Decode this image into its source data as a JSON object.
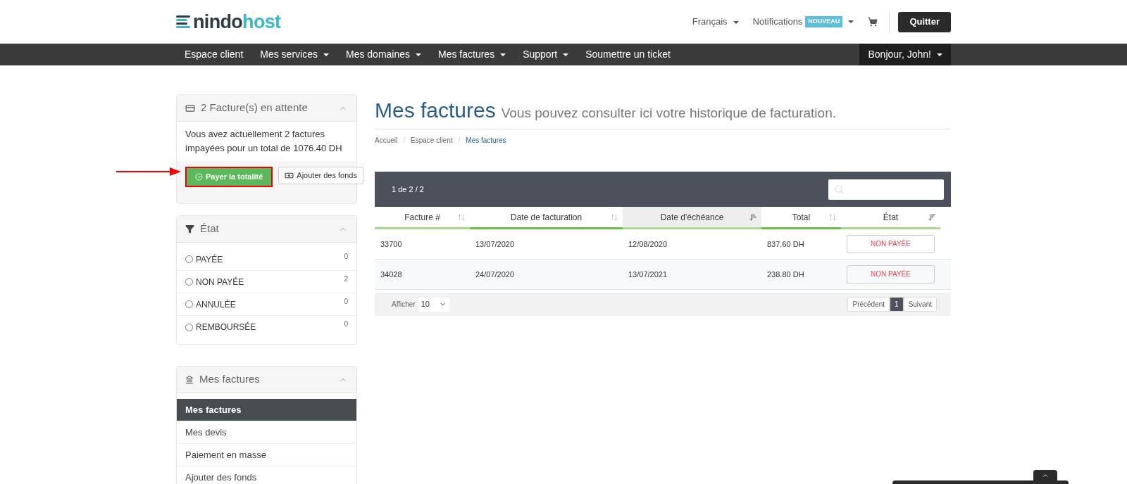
{
  "logo": {
    "dark": "nindo",
    "accent": "host"
  },
  "top_links": {
    "language": "Français",
    "notifications": "Notifications",
    "notifications_badge": "NOUVEAU",
    "logout": "Quitter"
  },
  "nav": {
    "items": [
      {
        "label": "Espace client",
        "dropdown": false
      },
      {
        "label": "Mes services",
        "dropdown": true
      },
      {
        "label": "Mes domaines",
        "dropdown": true
      },
      {
        "label": "Mes factures",
        "dropdown": true
      },
      {
        "label": "Support",
        "dropdown": true
      },
      {
        "label": "Soumettre un ticket",
        "dropdown": false
      }
    ],
    "user": "Bonjour, John!"
  },
  "pending_panel": {
    "title": "2 Facture(s) en attente",
    "message": "Vous avez actuellement 2 factures impayées pour un total de 1076.40 DH",
    "pay_button": "Payer la totalité",
    "pay_highlighted": true,
    "funds_button": "Ajouter des fonds"
  },
  "status_panel": {
    "title": "État",
    "options": [
      {
        "label": "PAYÉE",
        "count": "0",
        "selected": false
      },
      {
        "label": "NON PAYÉE",
        "count": "2",
        "selected": false
      },
      {
        "label": "ANNULÉE",
        "count": "0",
        "selected": false
      },
      {
        "label": "REMBOURSÉE",
        "count": "0",
        "selected": false
      }
    ]
  },
  "invoices_panel": {
    "title": "Mes factures",
    "items": [
      {
        "label": "Mes factures",
        "selected": true
      },
      {
        "label": "Mes devis",
        "selected": false
      },
      {
        "label": "Paiement en masse",
        "selected": false
      },
      {
        "label": "Ajouter des fonds",
        "selected": false
      }
    ]
  },
  "page": {
    "title": "Mes factures",
    "subtitle": "Vous pouvez consulter ici votre historique de facturation.",
    "breadcrumb_separator": "/",
    "breadcrumb": [
      {
        "label": "Accueil",
        "selected": false
      },
      {
        "label": "Espace client",
        "selected": false
      },
      {
        "label": "Mes factures",
        "selected": true
      }
    ]
  },
  "table": {
    "info": "1 de 2 / 2",
    "columns": [
      {
        "label": "Facture #",
        "kind": "unsorted"
      },
      {
        "label": "Date de facturation",
        "kind": "unsorted"
      },
      {
        "label": "Date d'échéance",
        "kind": "ascending"
      },
      {
        "label": "Total",
        "kind": "unsorted"
      },
      {
        "label": "État",
        "kind": "descending"
      }
    ],
    "rows": [
      {
        "cells": [
          "33700",
          "13/07/2020",
          "12/08/2020",
          "837.60 DH"
        ],
        "status": "NON PAYÉE"
      },
      {
        "cells": [
          "34028",
          "24/07/2020",
          "13/07/2021",
          "238.80 DH"
        ],
        "status": "NON PAYÉE"
      }
    ],
    "show_label": "Afficher",
    "page_size": "10",
    "pagination": [
      {
        "label": "Précédent",
        "selected": false
      },
      {
        "label": "1",
        "selected": true
      },
      {
        "label": "Suivant",
        "selected": false
      }
    ]
  }
}
